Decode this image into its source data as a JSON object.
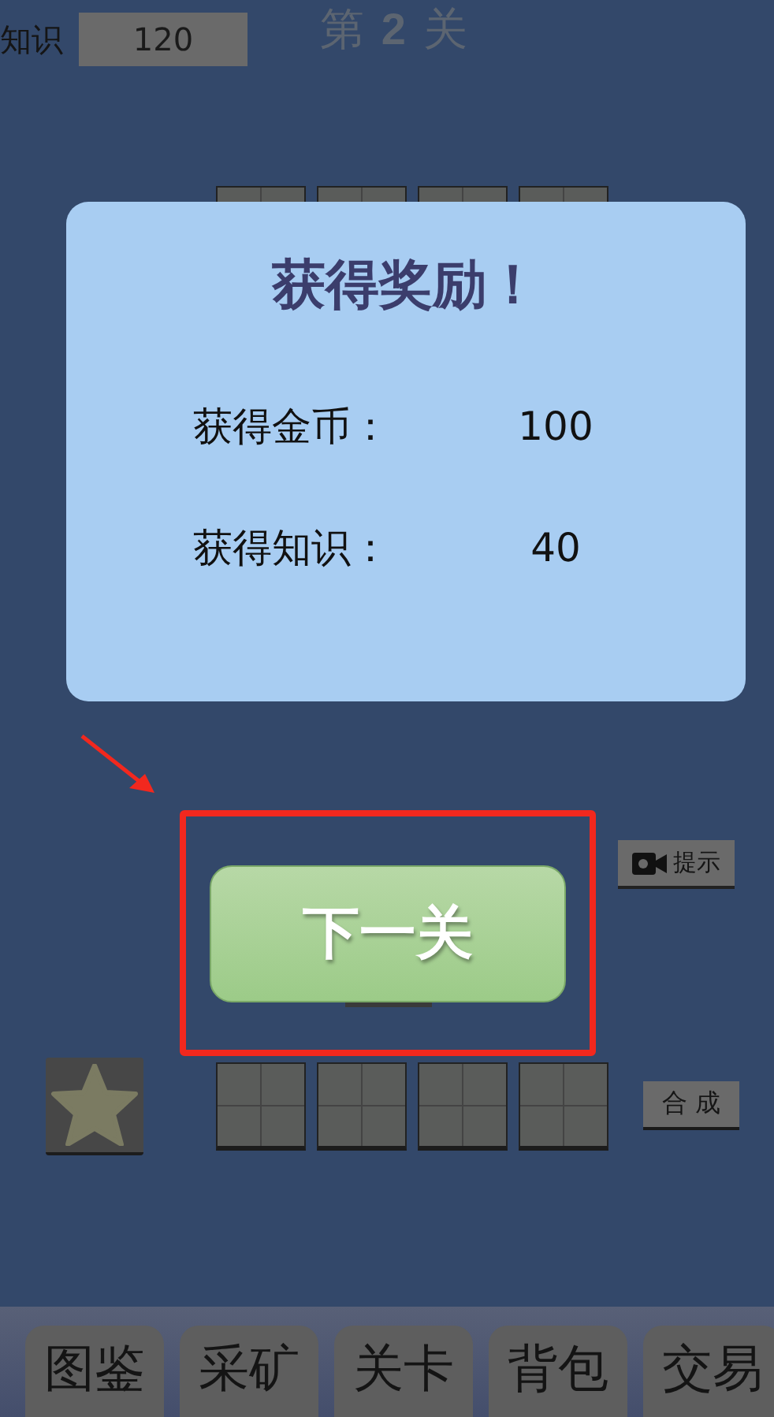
{
  "stats": {
    "label": "知识",
    "value": "120"
  },
  "level_title": "第 **2** 关",
  "dialog": {
    "title": "获得奖励！",
    "rows": [
      {
        "label": "获得金币：",
        "value": "100"
      },
      {
        "label": "获得知识：",
        "value": "40"
      }
    ]
  },
  "next_button": "下一关",
  "hint_button": "提示",
  "combine_button": "合 成",
  "tabs": [
    {
      "label": "图鉴"
    },
    {
      "label": "采矿"
    },
    {
      "label": "关卡"
    },
    {
      "label": "背包"
    },
    {
      "label": "交易"
    }
  ]
}
